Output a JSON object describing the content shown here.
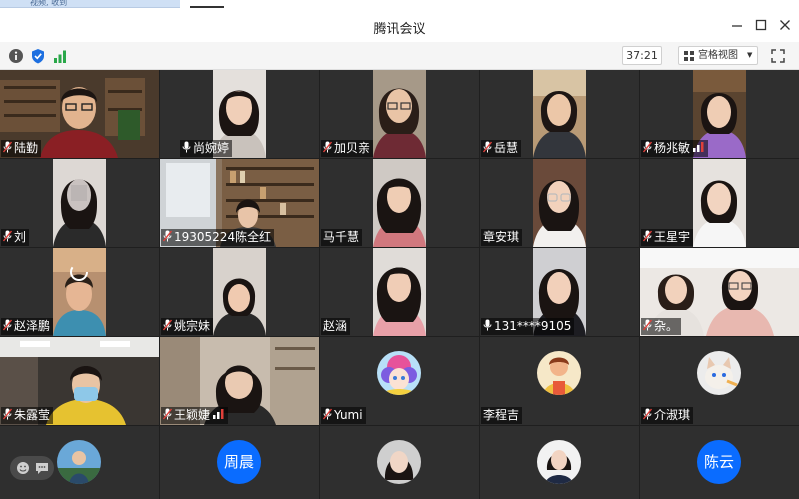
{
  "window": {
    "title": "腾讯会议",
    "top_tab_text": "视频, 收到"
  },
  "toolbar": {
    "timer": "37:21",
    "view_label": "宫格视图"
  },
  "participants": [
    {
      "name": "陆勤"
    },
    {
      "name": "尚婉婷"
    },
    {
      "name": "加贝亲"
    },
    {
      "name": "岳慧"
    },
    {
      "name": "杨兆敏"
    },
    {
      "name": "刘"
    },
    {
      "name": "19305224陈全红"
    },
    {
      "name": "马千慧"
    },
    {
      "name": "章安琪"
    },
    {
      "name": "王星宇"
    },
    {
      "name": "赵泽鹏"
    },
    {
      "name": "姚宗妹"
    },
    {
      "name": "赵涵"
    },
    {
      "name": "131****9105"
    },
    {
      "name": "杂。"
    },
    {
      "name": "朱露莹"
    },
    {
      "name": "王颖婕"
    },
    {
      "name": "Yumi"
    },
    {
      "name": "李程吉"
    },
    {
      "name": "介淑琪"
    },
    {
      "name": ""
    },
    {
      "name": "周晨",
      "initials": "周晨"
    },
    {
      "name": ""
    },
    {
      "name": ""
    },
    {
      "name": "陈云",
      "initials": "陈云"
    }
  ],
  "colors": {
    "accent": "#0a6cff",
    "host_badge": "#ff7a1a",
    "mic_muted": "#e0403a"
  },
  "icons": [
    "info-icon",
    "shield-icon",
    "signal-icon",
    "grid-view-icon",
    "fullscreen-icon",
    "microphone-muted-icon",
    "microphone-icon",
    "host-icon",
    "emoji-icon",
    "chat-icon"
  ]
}
